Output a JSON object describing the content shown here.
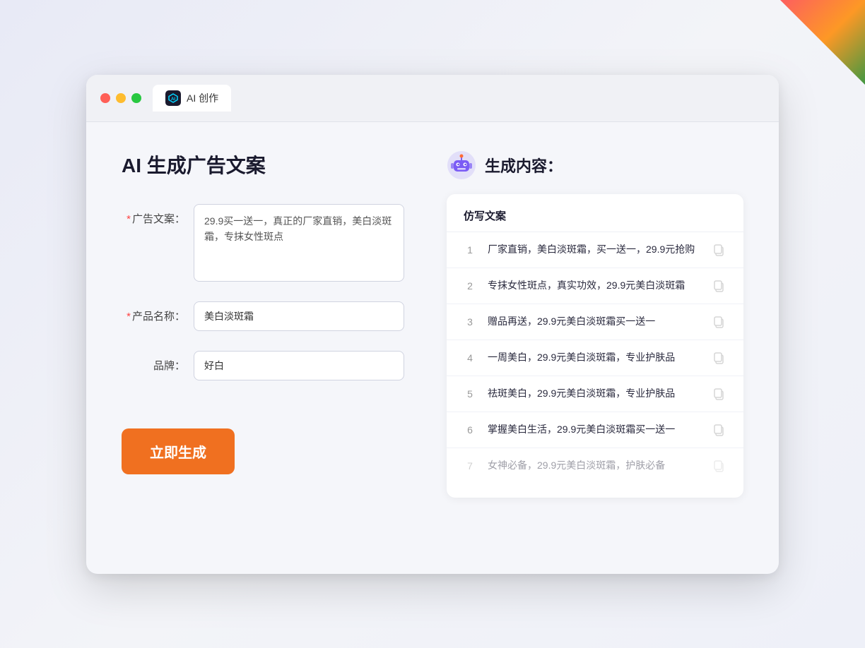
{
  "window": {
    "tab_label": "AI 创作"
  },
  "page": {
    "title": "AI 生成广告文案"
  },
  "form": {
    "ad_copy_label": "广告文案：",
    "ad_copy_required": "*",
    "ad_copy_value": "29.9买一送一，真正的厂家直销，美白淡斑霜，专抹女性斑点",
    "product_name_label": "产品名称：",
    "product_name_required": "*",
    "product_name_value": "美白淡斑霜",
    "brand_label": "品牌：",
    "brand_value": "好白",
    "generate_button": "立即生成"
  },
  "result": {
    "header": "生成内容：",
    "column_header": "仿写文案",
    "items": [
      {
        "num": "1",
        "text": "厂家直销，美白淡斑霜，买一送一，29.9元抢购",
        "faded": false
      },
      {
        "num": "2",
        "text": "专抹女性斑点，真实功效，29.9元美白淡斑霜",
        "faded": false
      },
      {
        "num": "3",
        "text": "赠品再送，29.9元美白淡斑霜买一送一",
        "faded": false
      },
      {
        "num": "4",
        "text": "一周美白，29.9元美白淡斑霜，专业护肤品",
        "faded": false
      },
      {
        "num": "5",
        "text": "祛斑美白，29.9元美白淡斑霜，专业护肤品",
        "faded": false
      },
      {
        "num": "6",
        "text": "掌握美白生活，29.9元美白淡斑霜买一送一",
        "faded": false
      },
      {
        "num": "7",
        "text": "女神必备，29.9元美白淡斑霜，护肤必备",
        "faded": true
      }
    ]
  }
}
